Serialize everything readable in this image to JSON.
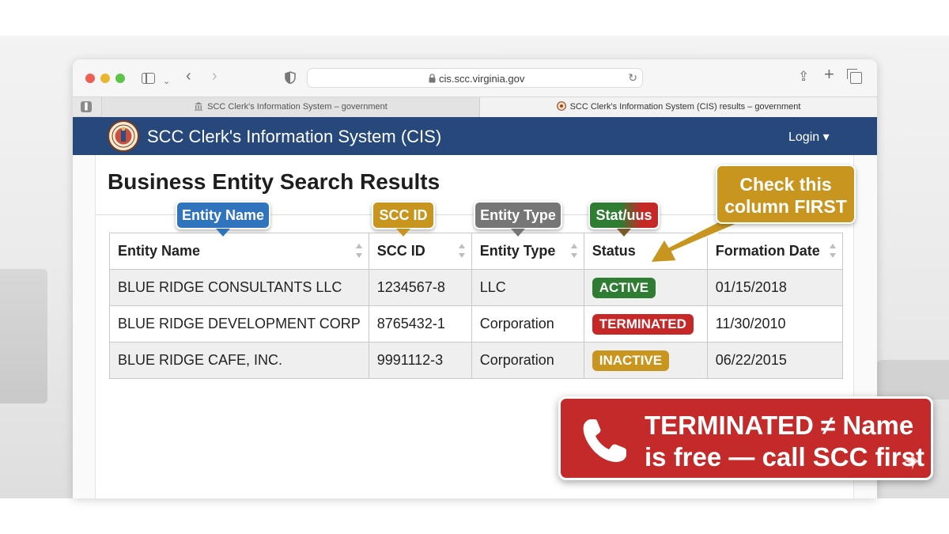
{
  "browser": {
    "url": "cis.scc.virginia.gov",
    "tabs": [
      {
        "label": "SCC Clerk's Information System – government"
      },
      {
        "label": "SCC Clerk's Information System (CIS) results – government"
      }
    ]
  },
  "site": {
    "title": "SCC Clerk's Information System (CIS)",
    "login_label": "Login ▾",
    "header_color": "#26487a"
  },
  "page": {
    "title": "Business Entity Search Results"
  },
  "table": {
    "columns": [
      "Entity Name",
      "SCC ID",
      "Entity Type",
      "Status",
      "Formation Date"
    ],
    "rows": [
      {
        "name": "BLUE RIDGE CONSULTANTS LLC",
        "scc_id": "1234567-8",
        "type": "LLC",
        "status": "ACTIVE",
        "formation_date": "01/15/2018"
      },
      {
        "name": "BLUE RIDGE DEVELOPMENT CORP",
        "scc_id": "8765432-1",
        "type": "Corporation",
        "status": "TERMINATED",
        "formation_date": "11/30/2010"
      },
      {
        "name": "BLUE RIDGE CAFE, INC.",
        "scc_id": "9991112-3",
        "type": "Corporation",
        "status": "INACTIVE",
        "formation_date": "06/22/2015"
      }
    ],
    "status_colors": {
      "ACTIVE": "#2e7d32",
      "TERMINATED": "#c62828",
      "INACTIVE": "#c8951f"
    }
  },
  "annotations": {
    "entity_name": "Entity Name",
    "scc_id": "SCC ID",
    "entity_type": "Entity Type",
    "status": "Stat/uus",
    "check_line1": "Check this",
    "check_line2": "column FIRST",
    "alert_line1": "TERMINATED ≠ Name",
    "alert_line2": "is free — call SCC first"
  },
  "icons": {
    "phone": "phone-icon",
    "seal": "virginia-seal-icon",
    "sparkle": "sparkle-icon"
  }
}
